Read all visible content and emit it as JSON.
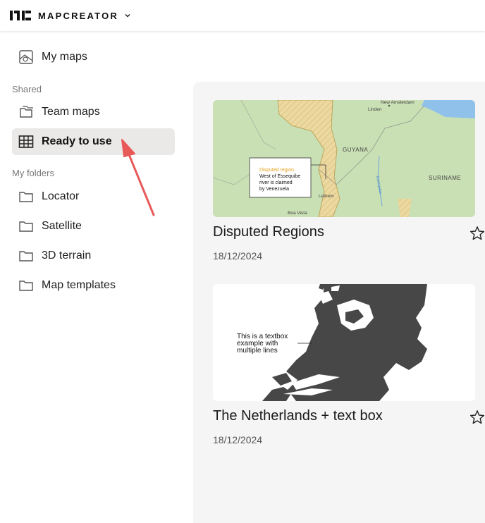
{
  "header": {
    "brand": "MAPCREATOR",
    "logo_icon": "mapcreator-logo-icon",
    "menu_icon": "chevron-down-icon"
  },
  "sidebar": {
    "my_maps": {
      "label": "My maps",
      "icon": "map-icon"
    },
    "shared_heading": "Shared",
    "shared_items": [
      {
        "label": "Team maps",
        "icon": "team-folder-icon"
      },
      {
        "label": "Ready to use",
        "icon": "map-grid-icon",
        "active": true
      }
    ],
    "folders_heading": "My folders",
    "folders": [
      {
        "label": "Locator",
        "icon": "folder-icon"
      },
      {
        "label": "Satellite",
        "icon": "folder-icon"
      },
      {
        "label": "3D terrain",
        "icon": "folder-icon"
      },
      {
        "label": "Map templates",
        "icon": "folder-icon"
      }
    ]
  },
  "maps": [
    {
      "title": "Disputed Regions",
      "date": "18/12/2024",
      "thumb": {
        "callout_heading": "Disputed region",
        "callout_body_1": "West of Essequibe",
        "callout_body_2": "river is claimed",
        "callout_body_3": "by Venezuela",
        "labels": [
          "New Amsterdam",
          "Linden",
          "GUYANA",
          "SURINAME",
          "Lethem",
          "Boa Vista",
          "Essequibo"
        ]
      }
    },
    {
      "title": "The Netherlands + text box",
      "date": "18/12/2024",
      "thumb": {
        "text_1": "This is a textbox",
        "text_2": "example with",
        "text_3": "multiple lines"
      }
    }
  ],
  "colors": {
    "active_bg": "#ebe9e8",
    "main_bg": "#f5f5f5",
    "arrow": "#e85a5a",
    "map_land": "#c9dfb4",
    "map_water": "#8fc1ea",
    "map_disputed": "#ecd9a2",
    "nl_land": "#474747"
  }
}
